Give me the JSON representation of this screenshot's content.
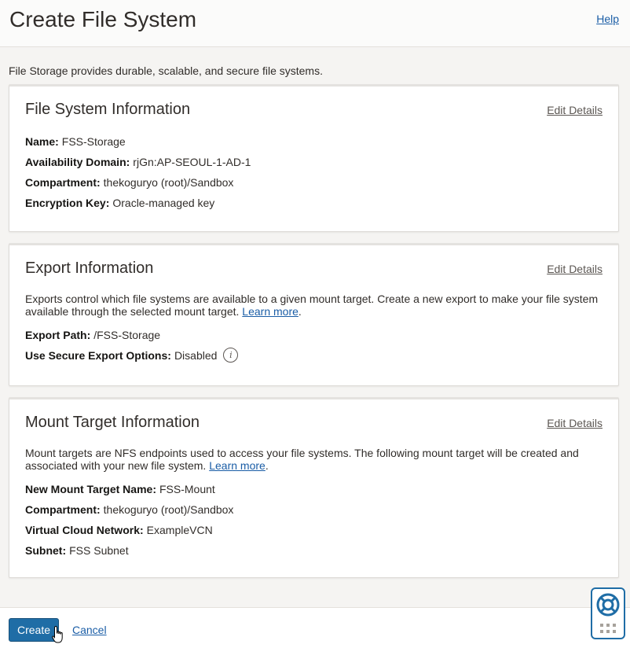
{
  "header": {
    "title": "Create File System",
    "help_label": "Help"
  },
  "intro": "File Storage provides durable, scalable, and secure file systems.",
  "file_system_info": {
    "title": "File System Information",
    "edit_label": "Edit Details",
    "fields": [
      {
        "label": "Name:",
        "value": "FSS-Storage"
      },
      {
        "label": "Availability Domain:",
        "value": "rjGn:AP-SEOUL-1-AD-1"
      },
      {
        "label": "Compartment:",
        "value": "thekoguryo (root)/Sandbox"
      },
      {
        "label": "Encryption Key:",
        "value": "Oracle-managed key"
      }
    ]
  },
  "export_info": {
    "title": "Export Information",
    "edit_label": "Edit Details",
    "description": "Exports control which file systems are available to a given mount target. Create a new export to make your file system available through the selected mount target.",
    "learn_more": "Learn more",
    "fields": [
      {
        "label": "Export Path:",
        "value": "/FSS-Storage"
      },
      {
        "label": "Use Secure Export Options:",
        "value": "Disabled"
      }
    ],
    "info_icon": "info-icon"
  },
  "mount_target_info": {
    "title": "Mount Target Information",
    "edit_label": "Edit Details",
    "description": "Mount targets are NFS endpoints used to access your file systems. The following mount target will be created and associated with your new file system.",
    "learn_more": "Learn more",
    "fields": [
      {
        "label": "New Mount Target Name:",
        "value": "FSS-Mount"
      },
      {
        "label": "Compartment:",
        "value": "thekoguryo (root)/Sandbox"
      },
      {
        "label": "Virtual Cloud Network:",
        "value": "ExampleVCN"
      },
      {
        "label": "Subnet:",
        "value": "FSS Subnet"
      }
    ]
  },
  "footer": {
    "create_label": "Create",
    "cancel_label": "Cancel"
  },
  "support_widget": {
    "icons": [
      "lifebuoy-icon",
      "grid-dots-icon"
    ]
  },
  "colors": {
    "primary_button": "#1f6da6",
    "link": "#1a5da6",
    "background": "#f5f4f2"
  }
}
